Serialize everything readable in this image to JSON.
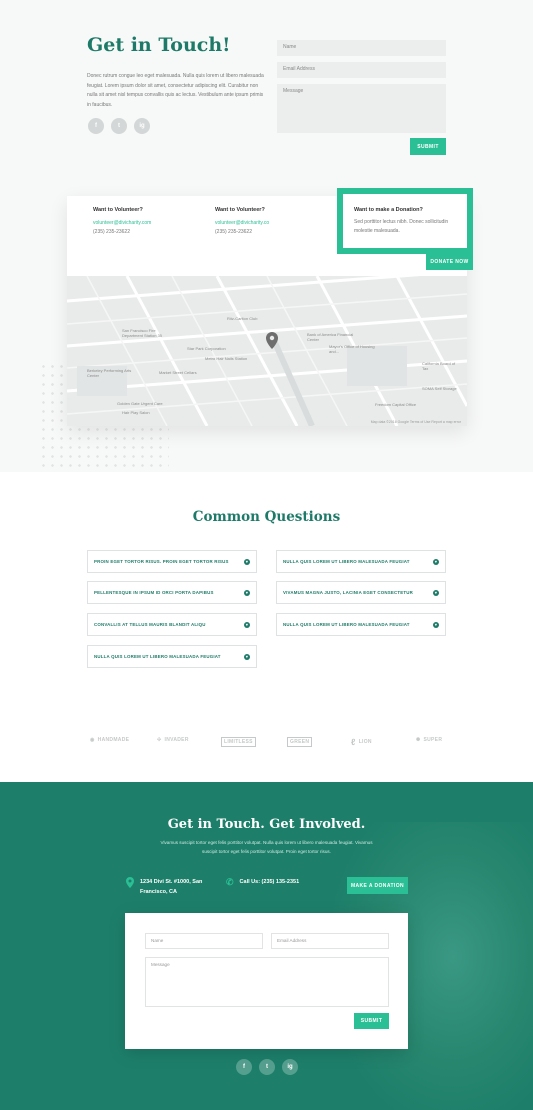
{
  "contact": {
    "heading": "Get in Touch!",
    "intro": "Donec rutrum congue leo eget malesuada. Nulla quis lorem ut libero malesuada feugiat. Lorem ipsum dolor sit amet, consectetur adipiscing elit. Curabitur non nulla sit amet nisl tempus convallis quis ac lectus. Vestibulum ante ipsum primis in faucibus.",
    "socials": [
      "f",
      "t",
      "ig"
    ],
    "form": {
      "name_placeholder": "Name",
      "email_placeholder": "Email Address",
      "message_placeholder": "Message",
      "submit_label": "SUBMIT"
    }
  },
  "info": {
    "columns": [
      {
        "title": "Want to Volunteer?",
        "email": "volunteer@divicharity.com",
        "phone": "(235) 235-23622"
      },
      {
        "title": "Want to Volunteer?",
        "email": "volunteer@divicharity.co",
        "phone": "(235) 235-23622"
      }
    ],
    "donation": {
      "title": "Want to make a Donation?",
      "text": "Sed porttitor lectus nibh. Donec sollicitudin molestie malesuada.",
      "button": "DONATE NOW"
    }
  },
  "map": {
    "labels": [
      "San Francisco Fire Department Station 35",
      "Ritz-Carlton Club",
      "Hills Plaza",
      "Bank of America Financial Center",
      "Mayor's Office of Housing and...",
      "Star Park Corporation",
      "Metro Hair Nails Station",
      "Market Street Cellars",
      "Berkeley Performing Arts Center",
      "Golden Gate Urgent Care",
      "Hair Play Salon",
      "Freedom Capital Office",
      "SOMA Self Storage",
      "California Board of Tax",
      "2005 Bestof Sunset",
      "Anchor Brewing Co"
    ],
    "footer": "Map data ©2016 Google   Terms of Use   Report a map error"
  },
  "faq": {
    "title": "Common Questions",
    "left": [
      "PROIN EGET TORTOR RISUS. PROIN EGET TORTOR RISUS",
      "PELLENTESQUE IN IPSUM ID ORCI PORTA DAPIBUS",
      "CONVALLIS AT TELLUS MAURIS BLANDIT ALIQU",
      "NULLA QUIS LOREM UT LIBERO MALESUADA FEUGIAT"
    ],
    "right": [
      "NULLA QUIS LOREM UT LIBERO MALESUADA FEUGIAT",
      "VIVAMUS MAGNA JUSTO, LACINIA EGET CONSECTETUR",
      "NULLA QUIS LOREM UT LIBERO MALESUADA FEUGIAT"
    ]
  },
  "logos": [
    "HANDMADE",
    "INVADER",
    "LIMITLESS",
    "GREEN",
    "LION",
    "SUPER"
  ],
  "footer": {
    "title": "Get in Touch. Get Involved.",
    "subtitle": "Vivamus suscipit tortor eget felis porttitor volutpat. Nulla quis lorem ut libero malesuada feugiat. Vivamus suscipit tortor eget felis porttitor volutpat. Proin eget tortor risus.",
    "address": "1234 Divi St. #1000, San Francisco, CA",
    "phone": "Call Us: (235) 135-2351",
    "donate_button": "MAKE A DONATION",
    "form": {
      "name_placeholder": "Name",
      "email_placeholder": "Email Address",
      "message_placeholder": "Message",
      "submit_label": "SUBMIT"
    },
    "socials": [
      "f",
      "t",
      "ig"
    ]
  },
  "colors": {
    "accent": "#2bbf95",
    "brand_dark": "#1e7a68",
    "footer_bg": "#1d7f6a"
  }
}
